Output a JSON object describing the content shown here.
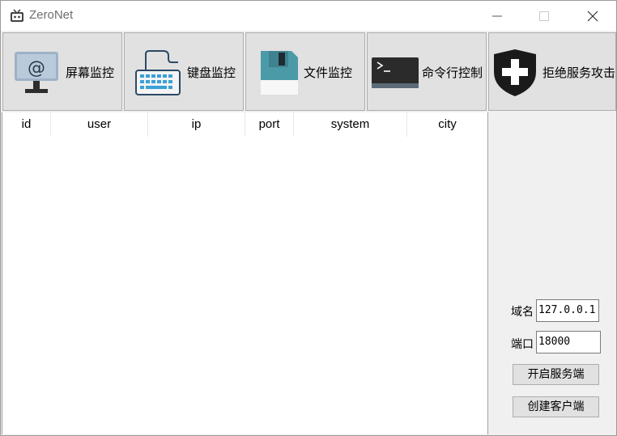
{
  "window": {
    "title": "ZeroNet"
  },
  "toolbar": {
    "screen_monitor": "屏幕监控",
    "keyboard_monitor": "键盘监控",
    "file_monitor": "文件监控",
    "command_control": "命令行控制",
    "ddos_attack": "拒绝服务攻击"
  },
  "table": {
    "columns": [
      "id",
      "user",
      "ip",
      "port",
      "system",
      "city"
    ],
    "rows": []
  },
  "side": {
    "domain_label": "域名",
    "domain_value": "127.0.0.1",
    "port_label": "端口",
    "port_value": "18000",
    "start_server": "开启服务端",
    "create_client": "创建客户端"
  }
}
